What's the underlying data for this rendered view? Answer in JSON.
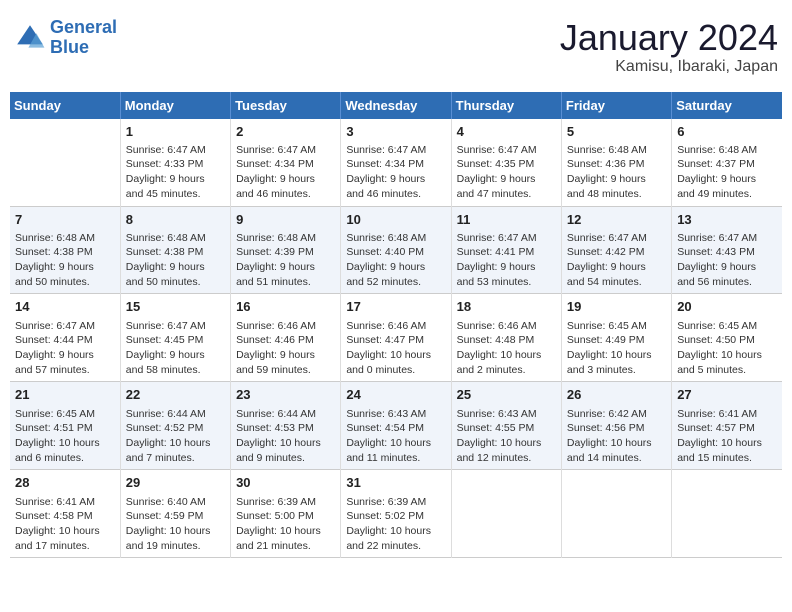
{
  "header": {
    "logo_line1": "General",
    "logo_line2": "Blue",
    "title": "January 2024",
    "subtitle": "Kamisu, Ibaraki, Japan"
  },
  "weekdays": [
    "Sunday",
    "Monday",
    "Tuesday",
    "Wednesday",
    "Thursday",
    "Friday",
    "Saturday"
  ],
  "weeks": [
    [
      {
        "day": "",
        "info": ""
      },
      {
        "day": "1",
        "info": "Sunrise: 6:47 AM\nSunset: 4:33 PM\nDaylight: 9 hours\nand 45 minutes."
      },
      {
        "day": "2",
        "info": "Sunrise: 6:47 AM\nSunset: 4:34 PM\nDaylight: 9 hours\nand 46 minutes."
      },
      {
        "day": "3",
        "info": "Sunrise: 6:47 AM\nSunset: 4:34 PM\nDaylight: 9 hours\nand 46 minutes."
      },
      {
        "day": "4",
        "info": "Sunrise: 6:47 AM\nSunset: 4:35 PM\nDaylight: 9 hours\nand 47 minutes."
      },
      {
        "day": "5",
        "info": "Sunrise: 6:48 AM\nSunset: 4:36 PM\nDaylight: 9 hours\nand 48 minutes."
      },
      {
        "day": "6",
        "info": "Sunrise: 6:48 AM\nSunset: 4:37 PM\nDaylight: 9 hours\nand 49 minutes."
      }
    ],
    [
      {
        "day": "7",
        "info": "Sunrise: 6:48 AM\nSunset: 4:38 PM\nDaylight: 9 hours\nand 50 minutes."
      },
      {
        "day": "8",
        "info": "Sunrise: 6:48 AM\nSunset: 4:38 PM\nDaylight: 9 hours\nand 50 minutes."
      },
      {
        "day": "9",
        "info": "Sunrise: 6:48 AM\nSunset: 4:39 PM\nDaylight: 9 hours\nand 51 minutes."
      },
      {
        "day": "10",
        "info": "Sunrise: 6:48 AM\nSunset: 4:40 PM\nDaylight: 9 hours\nand 52 minutes."
      },
      {
        "day": "11",
        "info": "Sunrise: 6:47 AM\nSunset: 4:41 PM\nDaylight: 9 hours\nand 53 minutes."
      },
      {
        "day": "12",
        "info": "Sunrise: 6:47 AM\nSunset: 4:42 PM\nDaylight: 9 hours\nand 54 minutes."
      },
      {
        "day": "13",
        "info": "Sunrise: 6:47 AM\nSunset: 4:43 PM\nDaylight: 9 hours\nand 56 minutes."
      }
    ],
    [
      {
        "day": "14",
        "info": "Sunrise: 6:47 AM\nSunset: 4:44 PM\nDaylight: 9 hours\nand 57 minutes."
      },
      {
        "day": "15",
        "info": "Sunrise: 6:47 AM\nSunset: 4:45 PM\nDaylight: 9 hours\nand 58 minutes."
      },
      {
        "day": "16",
        "info": "Sunrise: 6:46 AM\nSunset: 4:46 PM\nDaylight: 9 hours\nand 59 minutes."
      },
      {
        "day": "17",
        "info": "Sunrise: 6:46 AM\nSunset: 4:47 PM\nDaylight: 10 hours\nand 0 minutes."
      },
      {
        "day": "18",
        "info": "Sunrise: 6:46 AM\nSunset: 4:48 PM\nDaylight: 10 hours\nand 2 minutes."
      },
      {
        "day": "19",
        "info": "Sunrise: 6:45 AM\nSunset: 4:49 PM\nDaylight: 10 hours\nand 3 minutes."
      },
      {
        "day": "20",
        "info": "Sunrise: 6:45 AM\nSunset: 4:50 PM\nDaylight: 10 hours\nand 5 minutes."
      }
    ],
    [
      {
        "day": "21",
        "info": "Sunrise: 6:45 AM\nSunset: 4:51 PM\nDaylight: 10 hours\nand 6 minutes."
      },
      {
        "day": "22",
        "info": "Sunrise: 6:44 AM\nSunset: 4:52 PM\nDaylight: 10 hours\nand 7 minutes."
      },
      {
        "day": "23",
        "info": "Sunrise: 6:44 AM\nSunset: 4:53 PM\nDaylight: 10 hours\nand 9 minutes."
      },
      {
        "day": "24",
        "info": "Sunrise: 6:43 AM\nSunset: 4:54 PM\nDaylight: 10 hours\nand 11 minutes."
      },
      {
        "day": "25",
        "info": "Sunrise: 6:43 AM\nSunset: 4:55 PM\nDaylight: 10 hours\nand 12 minutes."
      },
      {
        "day": "26",
        "info": "Sunrise: 6:42 AM\nSunset: 4:56 PM\nDaylight: 10 hours\nand 14 minutes."
      },
      {
        "day": "27",
        "info": "Sunrise: 6:41 AM\nSunset: 4:57 PM\nDaylight: 10 hours\nand 15 minutes."
      }
    ],
    [
      {
        "day": "28",
        "info": "Sunrise: 6:41 AM\nSunset: 4:58 PM\nDaylight: 10 hours\nand 17 minutes."
      },
      {
        "day": "29",
        "info": "Sunrise: 6:40 AM\nSunset: 4:59 PM\nDaylight: 10 hours\nand 19 minutes."
      },
      {
        "day": "30",
        "info": "Sunrise: 6:39 AM\nSunset: 5:00 PM\nDaylight: 10 hours\nand 21 minutes."
      },
      {
        "day": "31",
        "info": "Sunrise: 6:39 AM\nSunset: 5:02 PM\nDaylight: 10 hours\nand 22 minutes."
      },
      {
        "day": "",
        "info": ""
      },
      {
        "day": "",
        "info": ""
      },
      {
        "day": "",
        "info": ""
      }
    ]
  ]
}
